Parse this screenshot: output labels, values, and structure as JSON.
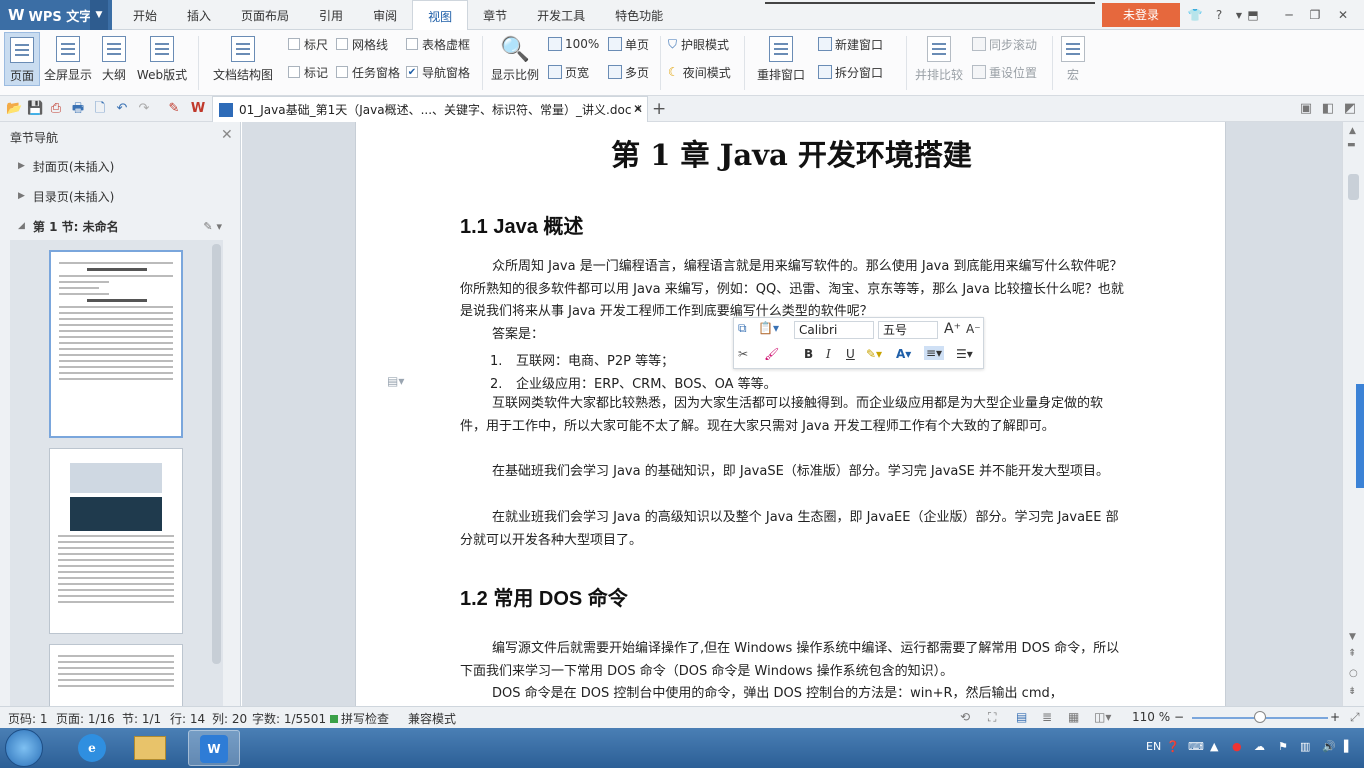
{
  "app": {
    "name": "WPS 文字",
    "login": "未登录",
    "help": "?"
  },
  "tabs": [
    "开始",
    "插入",
    "页面布局",
    "引用",
    "审阅",
    "视图",
    "章节",
    "开发工具",
    "特色功能"
  ],
  "ribbon": {
    "page": "页面",
    "fullscreen": "全屏显示",
    "outline": "大纲",
    "web": "Web版式",
    "docmap": "文档结构图",
    "ruler": "标尺",
    "gridlines": "网格线",
    "table_gridlines": "表格虚框",
    "marks": "标记",
    "taskpane": "任务窗格",
    "navpane": "导航窗格",
    "zoom": "显示比例",
    "zoom100": "100%",
    "pagewidth": "页宽",
    "single": "单页",
    "multi": "多页",
    "eyecare": "护眼模式",
    "night": "夜间模式",
    "arrange": "重排窗口",
    "newwin": "新建窗口",
    "split": "拆分窗口",
    "sidebyside": "并排比较",
    "syncscroll": "同步滚动",
    "resetpos": "重设位置",
    "macro": "宏"
  },
  "doc_tab": {
    "title": "01_Java基础_第1天（Java概述、...、关键字、标识符、常量）_讲义.doc *"
  },
  "nav": {
    "title": "章节导航",
    "items": [
      "封面页(未插入)",
      "目录页(未插入)"
    ],
    "section": "第 1 节: 未命名"
  },
  "doc": {
    "h1": "第 1 章   Java 开发环境搭建",
    "s1_title": "1.1     Java 概述",
    "p1": "众所周知 Java 是一门编程语言，编程语言就是用来编写软件的。那么使用 Java 到底能用来编写什么软件呢？你所熟知的很多软件都可以用 Java 来编写，例如：QQ、迅雷、淘宝、京东等等，那么 Java 比较擅长什么呢？也就是说我们将来从事 Java 开发工程师工作到底要编写什么类型的软件呢？",
    "p2": "答案是：",
    "li1_num": "1.",
    "li1": "互联网：电商、P2P 等等；",
    "li2_num": "2.",
    "li2": "企业级应用：ERP、CRM、BOS、OA 等等。",
    "p3": "互联网类软件大家都比较熟悉，因为大家生活都可以接触得到。而企业级应用都是为大型企业量身定做的软件，用于工作中，所以大家可能不太了解。现在大家只需对 Java 开发工程师工作有个大致的了解即可。",
    "p4": "在基础班我们会学习 Java 的基础知识，即 JavaSE（标准版）部分。学习完 JavaSE 并不能开发大型项目。",
    "p5": "在就业班我们会学习 Java 的高级知识以及整个 Java 生态圈，即 JavaEE（企业版）部分。学习完 JavaEE 部分就可以开发各种大型项目了。",
    "s2_title": "1.2     常用 DOS 命令",
    "p6": "编写源文件后就需要开始编译操作了,但在 Windows 操作系统中编译、运行都需要了解常用 DOS 命令，所以下面我们来学习一下常用 DOS 命令（DOS 命令是 Windows 操作系统包含的知识）。",
    "p7": "DOS 命令是在 DOS 控制台中使用的命令，弹出 DOS 控制台的方法是：win+R，然后输出 cmd，"
  },
  "float_toolbar": {
    "font": "Calibri",
    "size": "五号",
    "bold": "B",
    "italic": "I",
    "underline": "U"
  },
  "status": {
    "page_code": "页码: 1",
    "page": "页面: 1/16",
    "section": "节: 1/1",
    "row": "行: 14",
    "col": "列: 20",
    "words": "字数: 1/5501",
    "spell": "拼写检查",
    "compat": "兼容模式",
    "zoom": "110 %"
  },
  "taskbar": {
    "lang": "EN"
  },
  "colors": {
    "accent": "#3b6ea5",
    "login": "#e6683d",
    "active_tab": "#1f5fa8"
  }
}
